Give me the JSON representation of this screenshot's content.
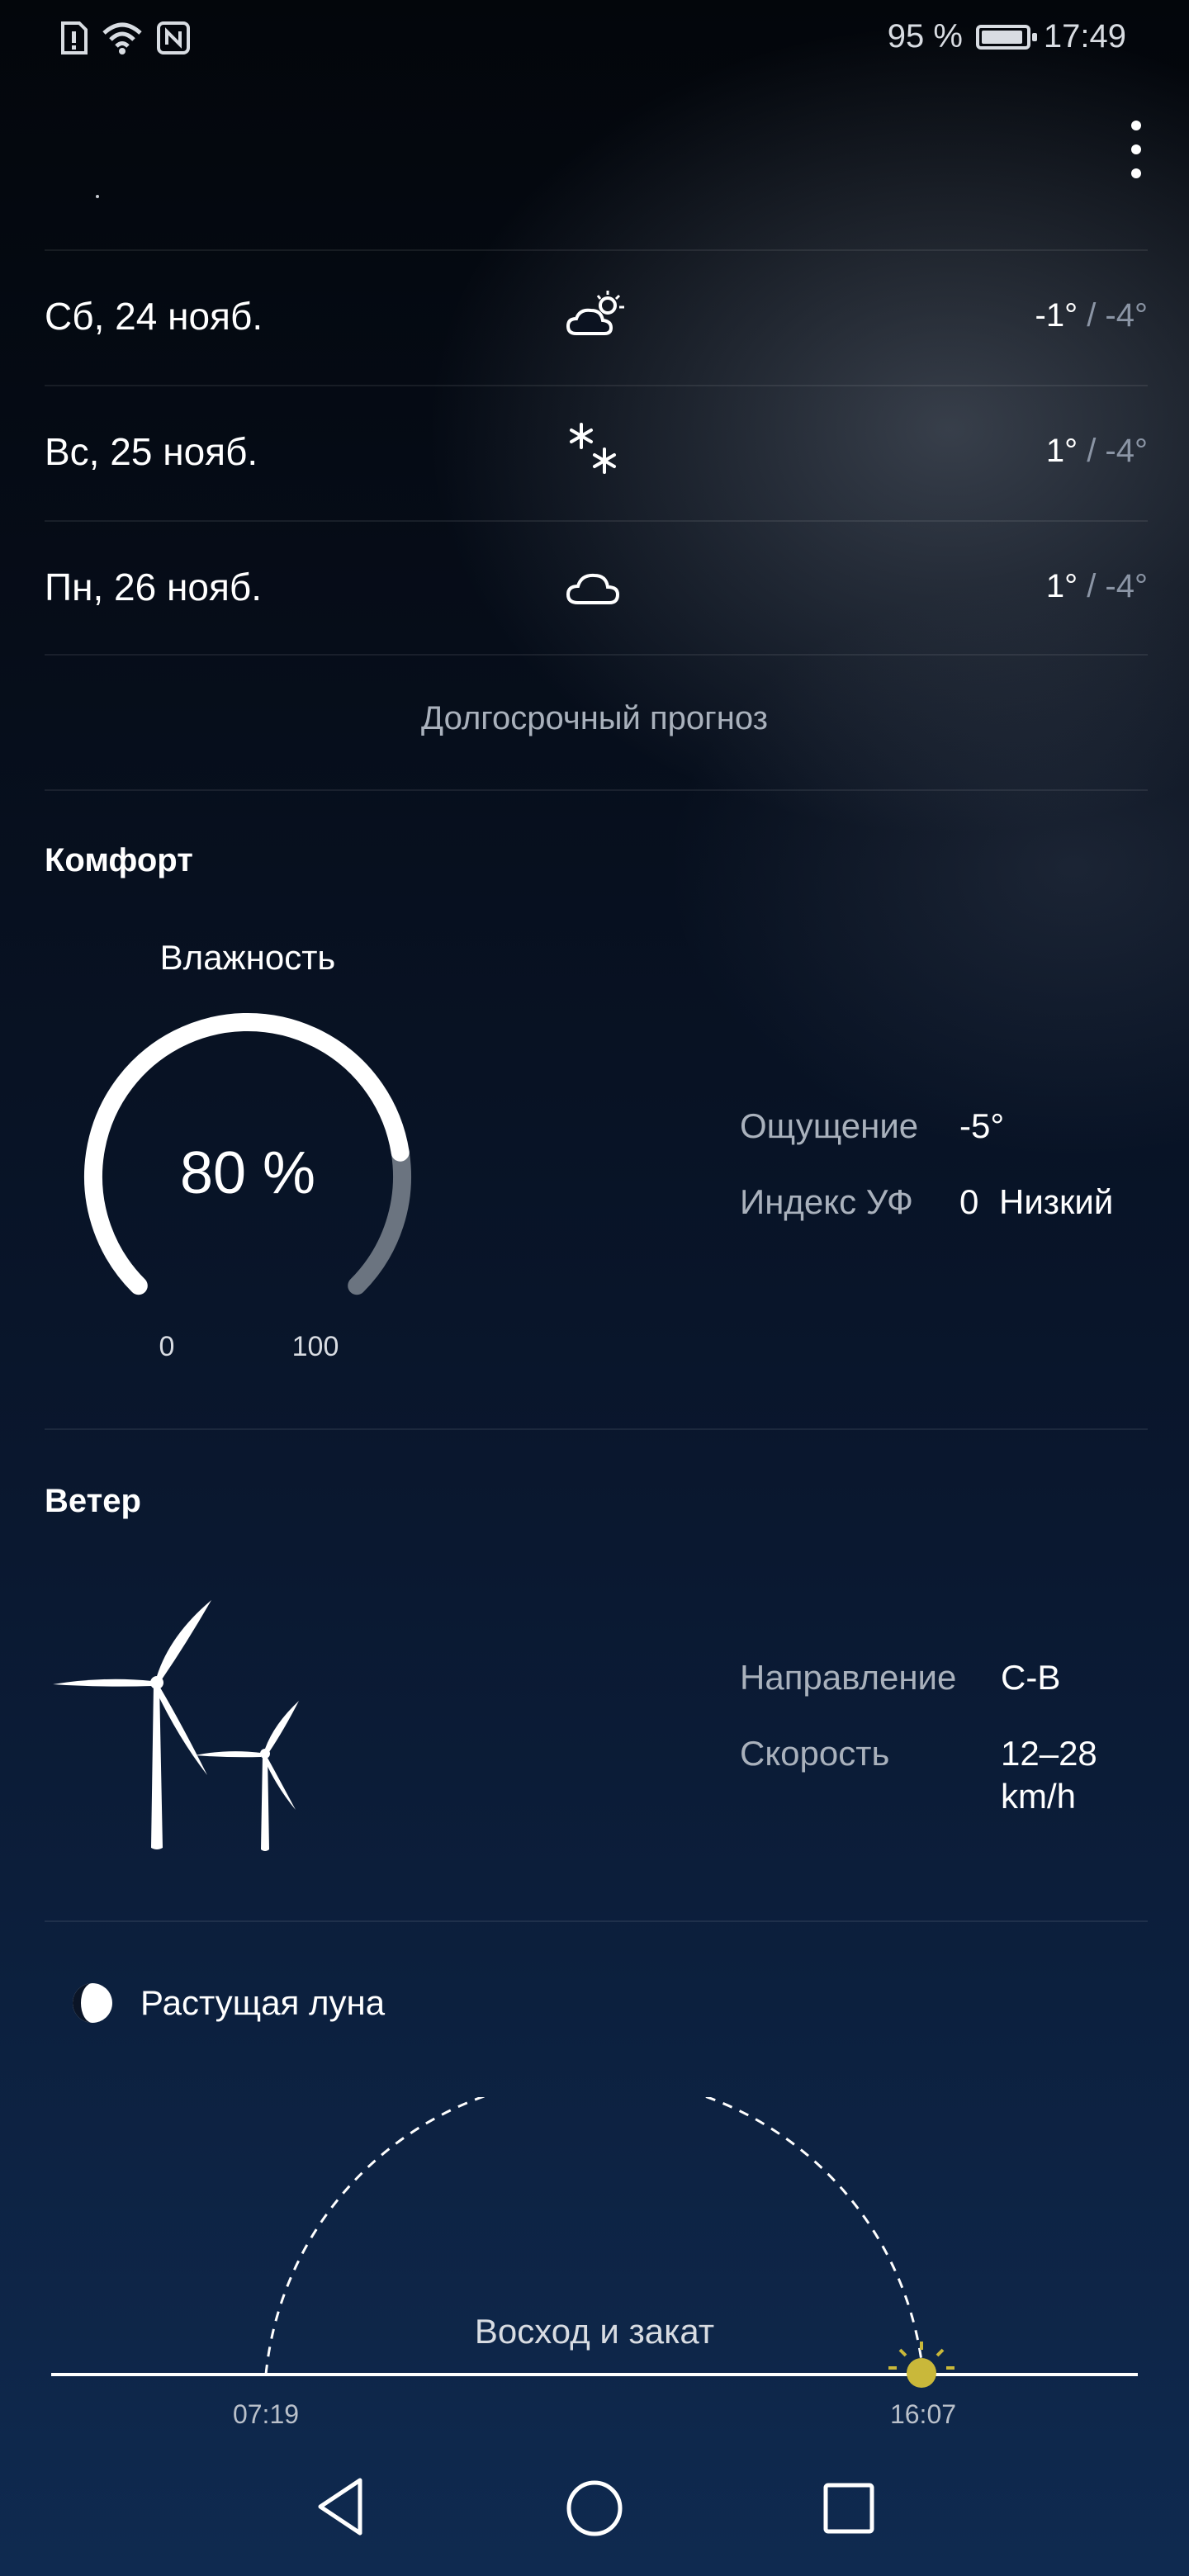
{
  "status": {
    "battery": "95 %",
    "time": "17:49",
    "icons": [
      "sim-alert-icon",
      "wifi-icon",
      "nfc-icon"
    ]
  },
  "forecast": [
    {
      "date": "Сб, 24 нояб.",
      "icon": "partly-sunny-icon",
      "high": "-1°",
      "low": " / -4°"
    },
    {
      "date": "Вс, 25 нояб.",
      "icon": "snow-icon",
      "high": "1°",
      "low": " / -4°"
    },
    {
      "date": "Пн, 26 нояб.",
      "icon": "cloud-icon",
      "high": "1°",
      "low": " / -4°"
    }
  ],
  "longterm_label": "Долгосрочный прогноз",
  "comfort": {
    "title": "Комфорт",
    "humidity_label": "Влажность",
    "humidity_value": "80 %",
    "humidity_fraction": 0.8,
    "gauge_min": "0",
    "gauge_max": "100",
    "feels_label": "Ощущение",
    "feels_value": "-5°",
    "uv_label": "Индекс УФ",
    "uv_value": "0",
    "uv_level": "Низкий"
  },
  "wind": {
    "title": "Ветер",
    "direction_label": "Направление",
    "direction_value": "С-В",
    "speed_label": "Скорость",
    "speed_value": "12–28",
    "speed_unit": "km/h"
  },
  "moon": {
    "phase": "Растущая луна",
    "icon": "moon-icon"
  },
  "sun": {
    "label": "Восход и закат",
    "sunrise": "07:19",
    "sunset": "16:07"
  },
  "colors": {
    "accent": "#ffffff",
    "muted": "#a9b1bc",
    "gauge_track": "#6b7480",
    "sun": "#c9b83a"
  }
}
